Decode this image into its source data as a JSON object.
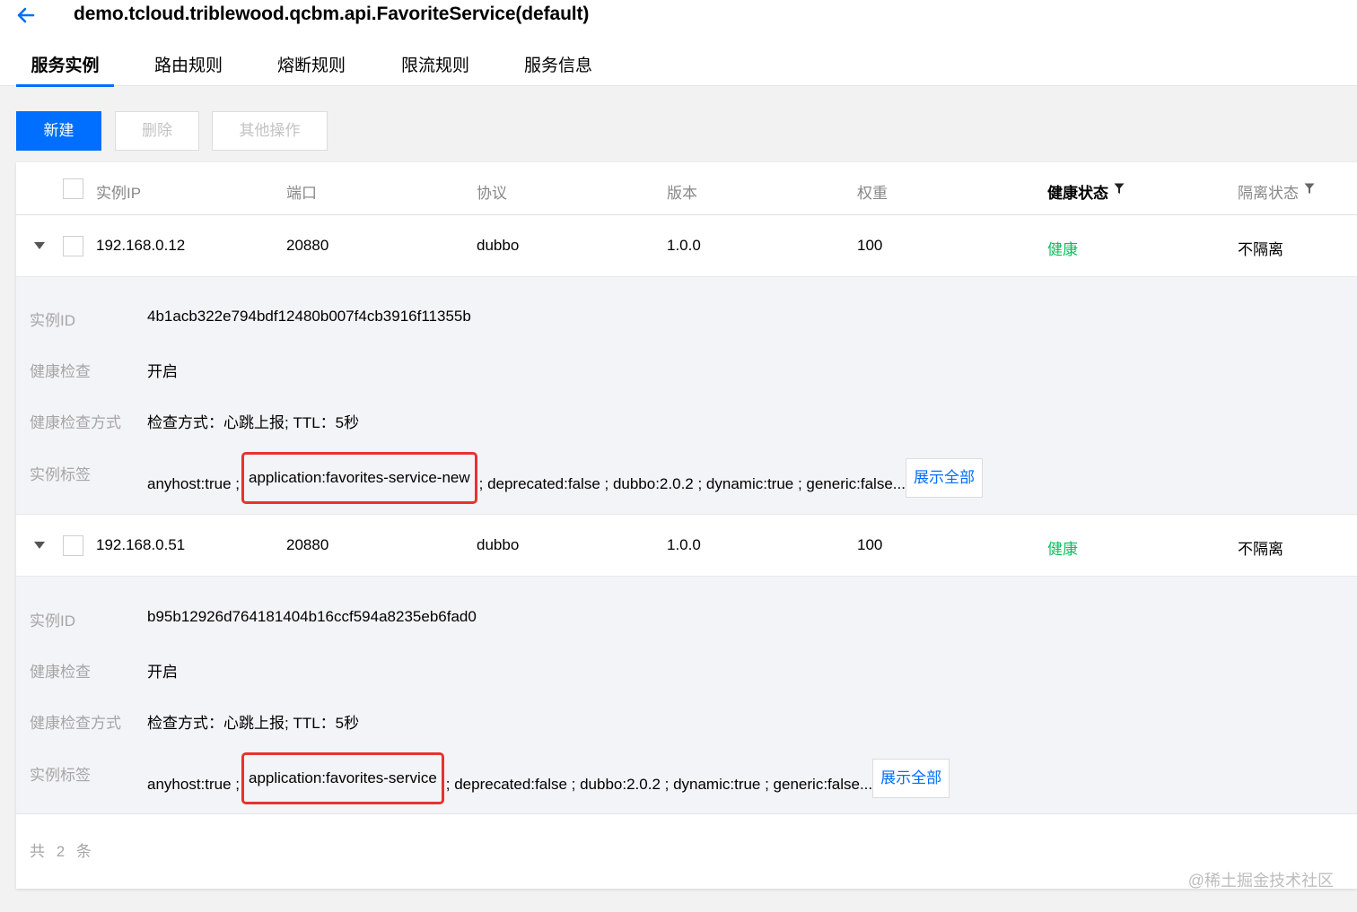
{
  "header": {
    "title": "demo.tcloud.triblewood.qcbm.api.FavoriteService(default)",
    "back_icon": "arrow-left-icon"
  },
  "tabs": [
    {
      "label": "服务实例",
      "active": true
    },
    {
      "label": "路由规则",
      "active": false
    },
    {
      "label": "熔断规则",
      "active": false
    },
    {
      "label": "限流规则",
      "active": false
    },
    {
      "label": "服务信息",
      "active": false
    }
  ],
  "toolbar": {
    "new_label": "新建",
    "delete_label": "删除",
    "more_label": "其他操作"
  },
  "table": {
    "columns": [
      "实例IP",
      "端口",
      "协议",
      "版本",
      "权重",
      "健康状态",
      "隔离状态"
    ],
    "rows": [
      {
        "ip": "192.168.0.12",
        "port": "20880",
        "protocol": "dubbo",
        "version": "1.0.0",
        "weight": "100",
        "health": "健康",
        "isolation": "不隔离",
        "detail": {
          "id_label": "实例ID",
          "id_value": "4b1acb322e794bdf12480b007f4cb3916f11355b",
          "hc_label": "健康检查",
          "hc_value": "开启",
          "hc_mode_label": "健康检查方式",
          "hc_mode_value": "检查方式：心跳上报; TTL：5秒",
          "tags_label": "实例标签",
          "tag_before": "anyhost:true ;",
          "tag_highlight": "application:favorites-service-new",
          "tag_after": "; deprecated:false ; dubbo:2.0.2 ; dynamic:true ; generic:false...",
          "show_all": "展示全部"
        }
      },
      {
        "ip": "192.168.0.51",
        "port": "20880",
        "protocol": "dubbo",
        "version": "1.0.0",
        "weight": "100",
        "health": "健康",
        "isolation": "不隔离",
        "detail": {
          "id_label": "实例ID",
          "id_value": "b95b12926d764181404b16ccf594a8235eb6fad0",
          "hc_label": "健康检查",
          "hc_value": "开启",
          "hc_mode_label": "健康检查方式",
          "hc_mode_value": "检查方式：心跳上报; TTL：5秒",
          "tags_label": "实例标签",
          "tag_before": "anyhost:true ;",
          "tag_highlight": "application:favorites-service",
          "tag_after": "; deprecated:false ; dubbo:2.0.2 ; dynamic:true ; generic:false...",
          "show_all": "展示全部"
        }
      }
    ],
    "total": "共 2 条"
  },
  "colors": {
    "primary": "#006eff",
    "healthy": "#0abf5b",
    "highlight_border": "#e8322e"
  },
  "watermark": "@稀土掘金技术社区"
}
